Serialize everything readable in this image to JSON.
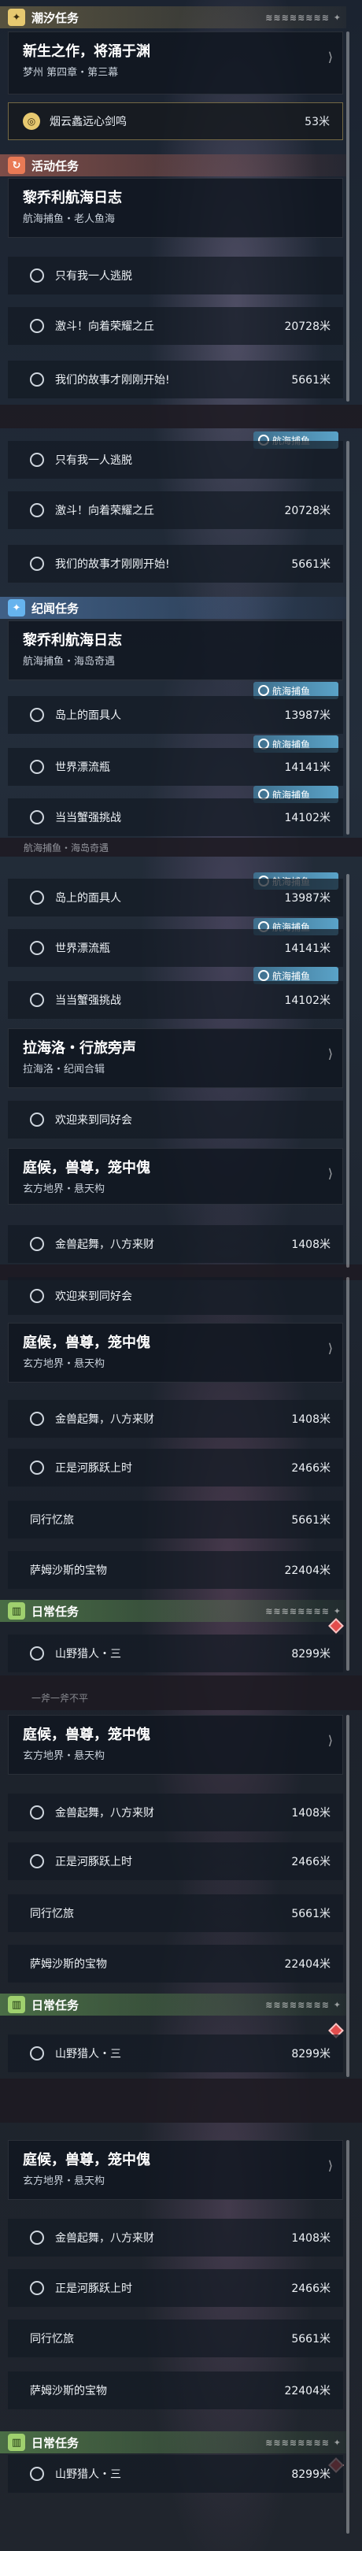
{
  "sections": {
    "tide": "潮汐任务",
    "activity": "活动任务",
    "chronicle": "纪闻任务",
    "daily": "日常任务"
  },
  "header_deco": "≋≋≋≋≋≋≋≋ ✦",
  "tide_card": {
    "title": "新生之作，将涌于渊",
    "subtitle": "梦州 第四章・第三幕"
  },
  "tide_item": {
    "label": "烟云蠡远心剑鸣",
    "distance": "53米",
    "icon": "◎"
  },
  "voyage": {
    "title": "黎乔利航海日志",
    "subtitle_activity": "航海捕鱼・老人鱼海",
    "subtitle_chronicle": "航海捕鱼・海岛奇遇"
  },
  "voyage_activity_items": [
    {
      "label": "只有我一人逃脱",
      "distance": ""
    },
    {
      "label": "激斗！向着荣耀之丘",
      "distance": "20728米"
    },
    {
      "label": "我们的故事才刚刚开始!",
      "distance": "5661米"
    }
  ],
  "voyage_chronicle_items": [
    {
      "label": "岛上的面具人",
      "distance": "13987米"
    },
    {
      "label": "世界漂流瓶",
      "distance": "14141米"
    },
    {
      "label": "当当蟹强挑战",
      "distance": "14102米"
    }
  ],
  "badge": "航海捕鱼",
  "lahai": {
    "title": "拉海洛・行旅旁声",
    "subtitle": "拉海洛・纪闻合辑",
    "item": "欢迎来到同好会"
  },
  "ting": {
    "title": "庭候，兽尊，笼中傀",
    "subtitle": "玄方地界・悬天构"
  },
  "ting_items": [
    {
      "label": "金兽起舞，八方来财",
      "distance": "1408米"
    },
    {
      "label": "正是河豚跃上时",
      "distance": "2466米"
    },
    {
      "label": "同行忆旅",
      "distance": "5661米"
    },
    {
      "label": "萨姆沙斯的宝物",
      "distance": "22404米"
    }
  ],
  "daily_item": {
    "label": "山野猎人・三",
    "distance": "8299米"
  },
  "cut_text": "航海捕鱼・海岛奇遇",
  "cut_text2": "一斧一斧不平"
}
